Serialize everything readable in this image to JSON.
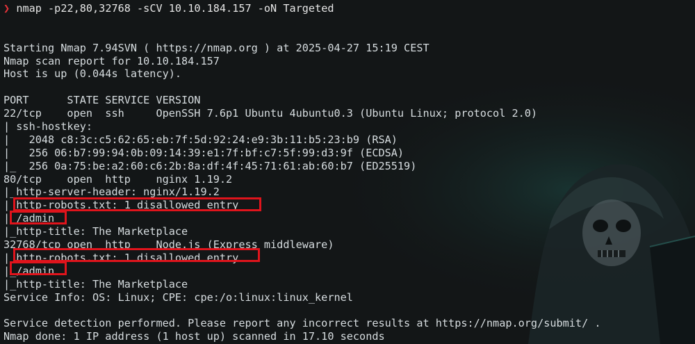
{
  "prompt": {
    "symbol": "❯",
    "command": "nmap -p22,80,32768 -sCV 10.10.184.157 -oN Targeted"
  },
  "output": [
    "",
    "",
    "Starting Nmap 7.94SVN ( https://nmap.org ) at 2025-04-27 15:19 CEST",
    "Nmap scan report for 10.10.184.157",
    "Host is up (0.044s latency).",
    "",
    "PORT      STATE SERVICE VERSION",
    "22/tcp    open  ssh     OpenSSH 7.6p1 Ubuntu 4ubuntu0.3 (Ubuntu Linux; protocol 2.0)",
    "| ssh-hostkey:",
    "|   2048 c8:3c:c5:62:65:eb:7f:5d:92:24:e9:3b:11:b5:23:b9 (RSA)",
    "|   256 06:b7:99:94:0b:09:14:39:e1:7f:bf:c7:5f:99:d3:9f (ECDSA)",
    "|_  256 0a:75:be:a2:60:c6:2b:8a:df:4f:45:71:61:ab:60:b7 (ED25519)",
    "80/tcp    open  http    nginx 1.19.2",
    "|_http-server-header: nginx/1.19.2",
    "| http-robots.txt: 1 disallowed entry",
    "|_/admin",
    "|_http-title: The Marketplace",
    "32768/tcp open  http    Node.js (Express middleware)",
    "| http-robots.txt: 1 disallowed entry",
    "|_/admin",
    "|_http-title: The Marketplace",
    "Service Info: OS: Linux; CPE: cpe:/o:linux:linux_kernel",
    "",
    "Service detection performed. Please report any incorrect results at https://nmap.org/submit/ .",
    "Nmap done: 1 IP address (1 host up) scanned in 17.10 seconds"
  ],
  "colors": {
    "background": "#131617",
    "text": "#d7dde0",
    "prompt_arrow": "#e8333a",
    "highlight_box": "#e0141c"
  }
}
